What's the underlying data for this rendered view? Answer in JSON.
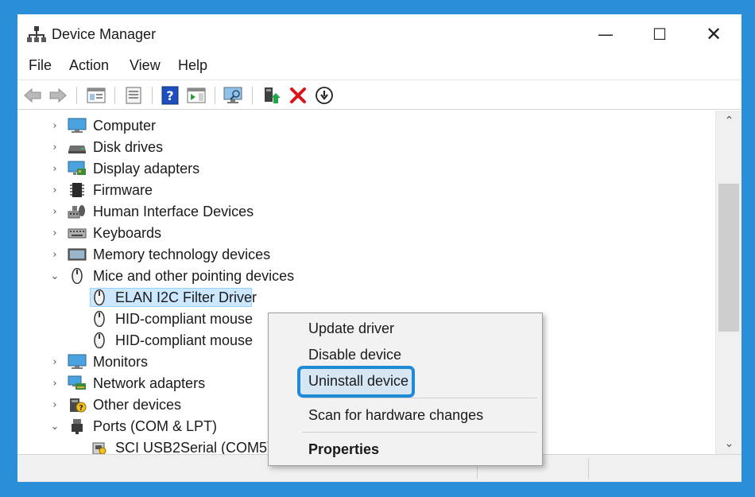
{
  "window": {
    "title": "Device Manager",
    "controls": {
      "minimize": "—",
      "maximize": "☐",
      "close": "✕"
    }
  },
  "menu": [
    "File",
    "Action",
    "View",
    "Help"
  ],
  "toolbar": {
    "buttons": [
      "back-icon",
      "forward-icon",
      "show-hide-console-tree-icon",
      "properties-icon",
      "help-icon",
      "action-pane-icon",
      "scan-monitor-icon",
      "update-driver-icon",
      "uninstall-icon",
      "download-icon"
    ]
  },
  "tree": {
    "categories": [
      {
        "label": "Computer",
        "expanded": false,
        "icon": "computer-icon"
      },
      {
        "label": "Disk drives",
        "expanded": false,
        "icon": "disk-drive-icon"
      },
      {
        "label": "Display adapters",
        "expanded": false,
        "icon": "display-adapter-icon"
      },
      {
        "label": "Firmware",
        "expanded": false,
        "icon": "firmware-icon"
      },
      {
        "label": "Human Interface Devices",
        "expanded": false,
        "icon": "hid-icon"
      },
      {
        "label": "Keyboards",
        "expanded": false,
        "icon": "keyboard-icon"
      },
      {
        "label": "Memory technology devices",
        "expanded": false,
        "icon": "memory-icon"
      },
      {
        "label": "Mice and other pointing devices",
        "expanded": true,
        "icon": "mouse-icon",
        "children": [
          "ELAN I2C Filter Driver",
          "HID-compliant mouse",
          "HID-compliant mouse"
        ]
      },
      {
        "label": "Monitors",
        "expanded": false,
        "icon": "monitor-icon"
      },
      {
        "label": "Network adapters",
        "expanded": false,
        "icon": "network-adapter-icon"
      },
      {
        "label": "Other devices",
        "expanded": false,
        "icon": "other-devices-icon"
      },
      {
        "label": "Ports (COM & LPT)",
        "expanded": true,
        "icon": "port-icon",
        "children": [
          "SCI USB2Serial (COM5)"
        ]
      }
    ],
    "selected": "ELAN I2C Filter Driver"
  },
  "context_menu": {
    "items": [
      "Update driver",
      "Disable device",
      "Uninstall device",
      "Scan for hardware changes",
      "Properties"
    ],
    "highlighted": "Uninstall device",
    "default_item": "Properties"
  },
  "colors": {
    "frame": "#2b8ed8",
    "selection": "#cce8ff",
    "highlight_border": "#1f8ad6",
    "uninstall_red": "#d9141b"
  }
}
